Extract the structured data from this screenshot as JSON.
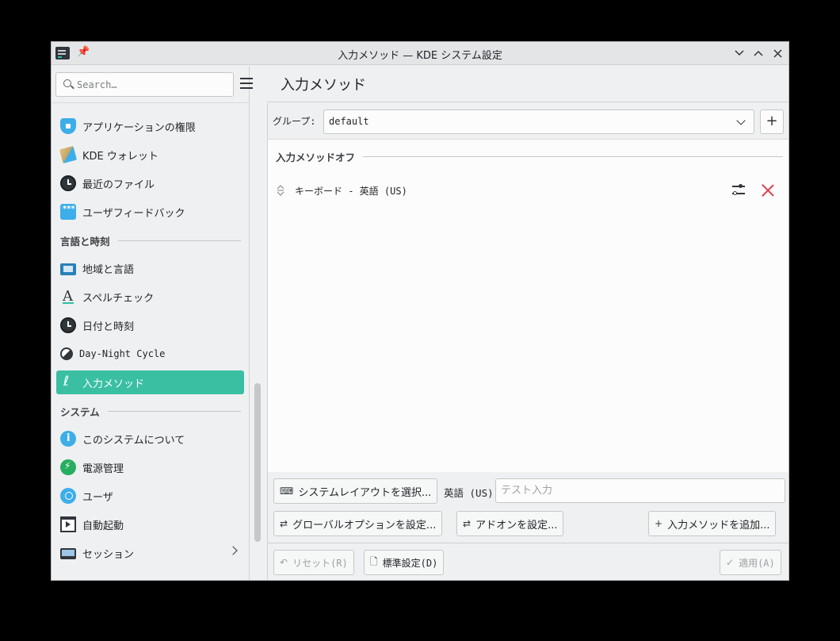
{
  "window": {
    "title": "入力メソッド — KDE システム設定"
  },
  "sidebar": {
    "search_placeholder": "Search…",
    "items": [
      {
        "label": "アプリケーションの権限",
        "icon": "shield-icon"
      },
      {
        "label": "KDE ウォレット",
        "icon": "wallet-icon"
      },
      {
        "label": "最近のファイル",
        "icon": "clock-icon"
      },
      {
        "label": "ユーザフィードバック",
        "icon": "feedback-icon"
      },
      {
        "label": "地域と言語",
        "icon": "monitor-icon"
      },
      {
        "label": "スペルチェック",
        "icon": "spellcheck-icon"
      },
      {
        "label": "日付と時刻",
        "icon": "clock-icon"
      },
      {
        "label": "Day-Night Cycle",
        "icon": "day-night-icon"
      },
      {
        "label": "入力メソッド",
        "icon": "input-method-icon",
        "active": true
      },
      {
        "label": "このシステムについて",
        "icon": "info-icon"
      },
      {
        "label": "電源管理",
        "icon": "power-icon"
      },
      {
        "label": "ユーザ",
        "icon": "users-icon"
      },
      {
        "label": "自動起動",
        "icon": "autostart-icon"
      },
      {
        "label": "セッション",
        "icon": "session-icon"
      }
    ],
    "sections": {
      "language_time": "言語と時刻",
      "system": "システム"
    }
  },
  "main": {
    "title": "入力メソッド",
    "group_label": "グループ:",
    "group_value": "default",
    "add_group_label": "+",
    "section_title": "入力メソッドオフ",
    "input_methods": [
      {
        "name": "キーボード - 英語 (US)"
      }
    ]
  },
  "bottom": {
    "select_layout_label": "システムレイアウトを選択...",
    "layout_name": "英語 (US)",
    "test_placeholder": "テスト入力",
    "global_options_label": "グローバルオプションを設定...",
    "addons_label": "アドオンを設定...",
    "add_im_label": "入力メソッドを追加...",
    "reset_label": "リセット(R)",
    "defaults_label": "標準設定(D)",
    "apply_label": "適用(A)"
  },
  "colors": {
    "accent": "#3abfa3",
    "danger": "#da4453"
  }
}
